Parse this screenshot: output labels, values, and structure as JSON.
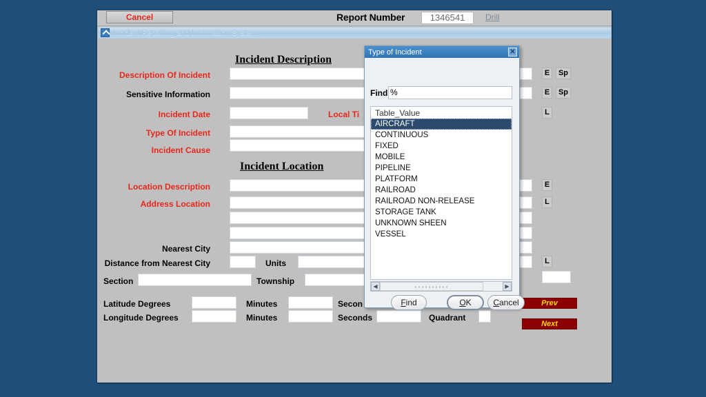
{
  "desktop": {
    "background_color": "#1f4e79"
  },
  "toolbar": {
    "cancel_label": "Cancel",
    "report_number_label": "Report Number",
    "report_number_value": "1346541",
    "drill_label": "Drill"
  },
  "window": {
    "title": "Incident Reporting and Information System",
    "doc_icon": "document-icon"
  },
  "form": {
    "sections": {
      "incident_description": "Incident Description",
      "incident_location": "Incident Location"
    },
    "labels": {
      "description_of_incident": "Description Of Incident",
      "sensitive_information": "Sensitive Information",
      "incident_date": "Incident Date",
      "local_time": "Local Ti",
      "type_of_incident": "Type Of Incident",
      "incident_cause": "Incident Cause",
      "location_description": "Location Description",
      "address_location": "Address Location",
      "nearest_city": "Nearest City",
      "distance_from_nearest_city": "Distance from Nearest City",
      "units": "Units",
      "section": "Section",
      "township": "Township",
      "latitude_degrees": "Latitude Degrees",
      "longitude_degrees": "Longitude Degrees",
      "minutes_lat": "Minutes",
      "minutes_lon": "Minutes",
      "seconds_lat": "Secon",
      "seconds_lon": "Seconds",
      "quadrant": "Quadrant"
    },
    "values": {
      "description_of_incident": "",
      "sensitive_information": "",
      "incident_date": "",
      "type_of_incident": "",
      "incident_cause": "",
      "location_description": "",
      "address_location_1": "",
      "address_location_2": "",
      "address_location_3": "",
      "nearest_city": "",
      "distance": "",
      "units": "",
      "section": "",
      "township": "",
      "lat_degrees": "",
      "lat_minutes": "",
      "lat_seconds": "",
      "lon_degrees": "",
      "lon_minutes": "",
      "lon_seconds": "",
      "quadrant": ""
    },
    "mini_buttons": {
      "e1": "E",
      "sp1": "Sp",
      "e2": "E",
      "sp2": "Sp",
      "l1": "L",
      "e3": "E",
      "l2": "L",
      "l3": "L"
    },
    "nav": {
      "prev": "Prev",
      "next": "Next"
    }
  },
  "dialog": {
    "title": "Type of Incident",
    "close_icon": "close-icon",
    "find_label": "Find",
    "find_value": "%",
    "list_header": "Table_Value",
    "items": [
      "AIRCRAFT",
      "CONTINUOUS",
      "FIXED",
      "MOBILE",
      "PIPELINE",
      "PLATFORM",
      "RAILROAD",
      "RAILROAD NON-RELEASE",
      "STORAGE TANK",
      "UNKNOWN SHEEN",
      "VESSEL"
    ],
    "selected_index": 0,
    "scroll_left_icon": "chevron-left-icon",
    "scroll_right_icon": "chevron-right-icon",
    "buttons": {
      "find": "Find",
      "find_mnemonic": "F",
      "ok": "OK",
      "ok_mnemonic": "O",
      "cancel": "Cancel",
      "cancel_mnemonic": "C"
    }
  }
}
